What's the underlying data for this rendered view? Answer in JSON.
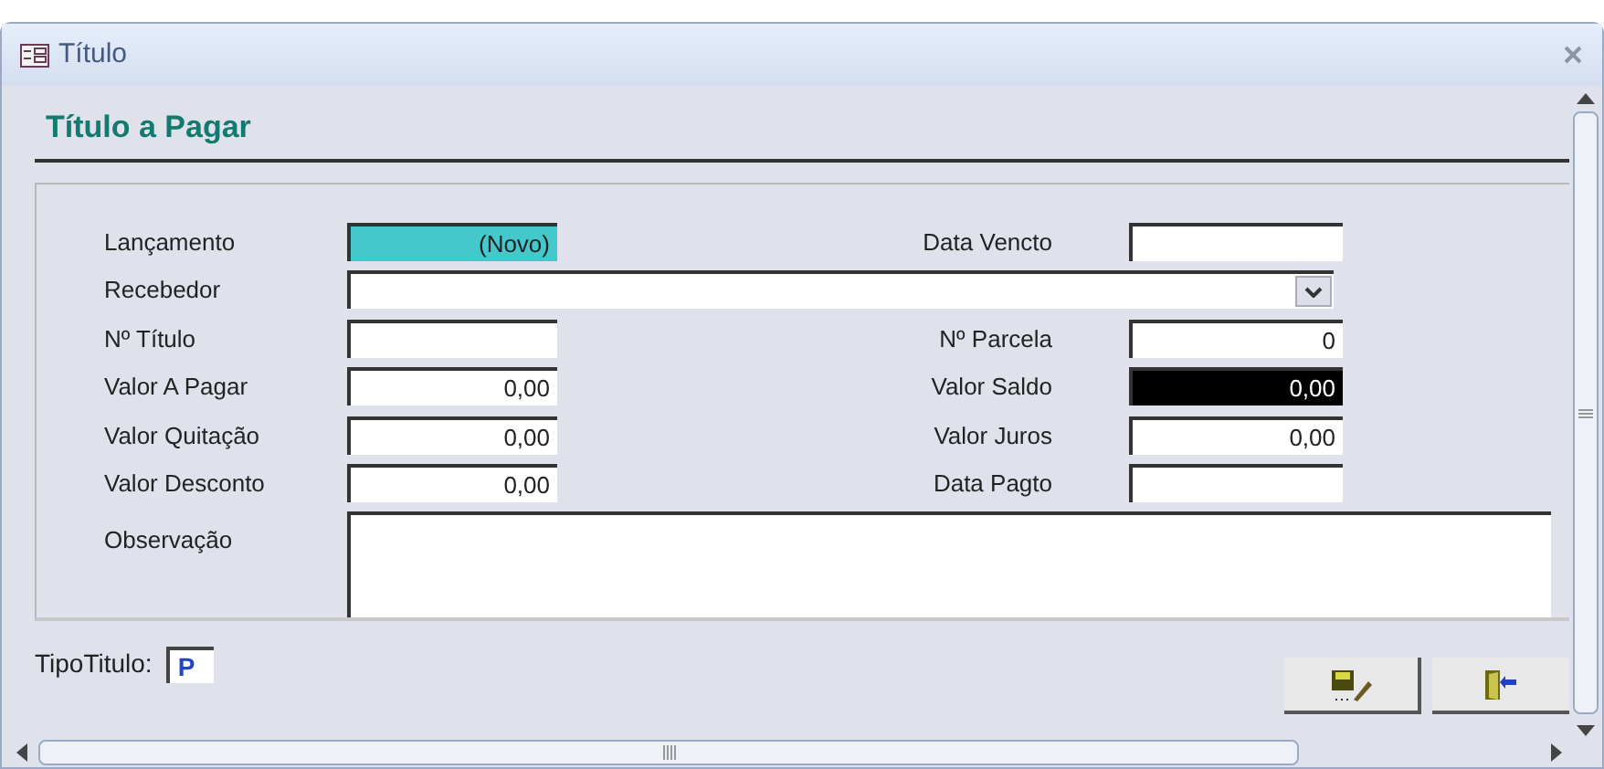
{
  "window": {
    "title": "Título"
  },
  "header": {
    "title": "Título a Pagar"
  },
  "rows": [
    {
      "left": {
        "label": "Lançamento",
        "kind": "autonumber",
        "value": "(Novo)",
        "selected": false
      },
      "right": {
        "label": "Data Vencto",
        "kind": "text",
        "selected": false
      }
    },
    {
      "left": {
        "label": "Recebedor",
        "kind": "combo",
        "selected": false
      }
    },
    {
      "left": {
        "label": "Nº Título",
        "kind": "text",
        "selected": false
      },
      "right": {
        "label": "Nº Parcela",
        "kind": "text",
        "value": "0",
        "selected": false
      }
    },
    {
      "left": {
        "label": "Valor A Pagar",
        "kind": "text",
        "value": "0,00",
        "selected": false
      },
      "right": {
        "label": "Valor Saldo",
        "kind": "text",
        "value": "0,00",
        "selected": true
      }
    },
    {
      "left": {
        "label": "Valor Quitação",
        "kind": "text",
        "value": "0,00",
        "selected": false
      },
      "right": {
        "label": "Valor Juros",
        "kind": "text",
        "value": "0,00",
        "selected": false
      }
    },
    {
      "left": {
        "label": "Valor Desconto",
        "kind": "text",
        "value": "0,00",
        "selected": false
      },
      "right": {
        "label": "Data Pagto",
        "kind": "text",
        "selected": false
      }
    },
    {
      "left": {
        "label": "Observação",
        "kind": "memo",
        "selected": false
      }
    }
  ],
  "footer": {
    "label": "TipoTitulo:",
    "value": "P"
  }
}
